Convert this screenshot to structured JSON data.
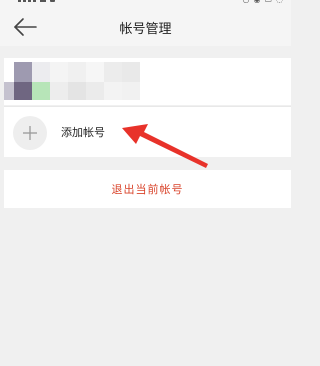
{
  "header": {
    "title": "帐号管理",
    "back_icon": "arrow-left-icon"
  },
  "account": {
    "avatar_icon": "avatar-mosaic"
  },
  "add_account": {
    "label": "添加帐号",
    "icon": "plus-icon"
  },
  "logout": {
    "label": "退出当前帐号",
    "color": "#d9442b"
  },
  "annotation": {
    "color": "#e8322a",
    "icon": "red-arrow-icon"
  }
}
